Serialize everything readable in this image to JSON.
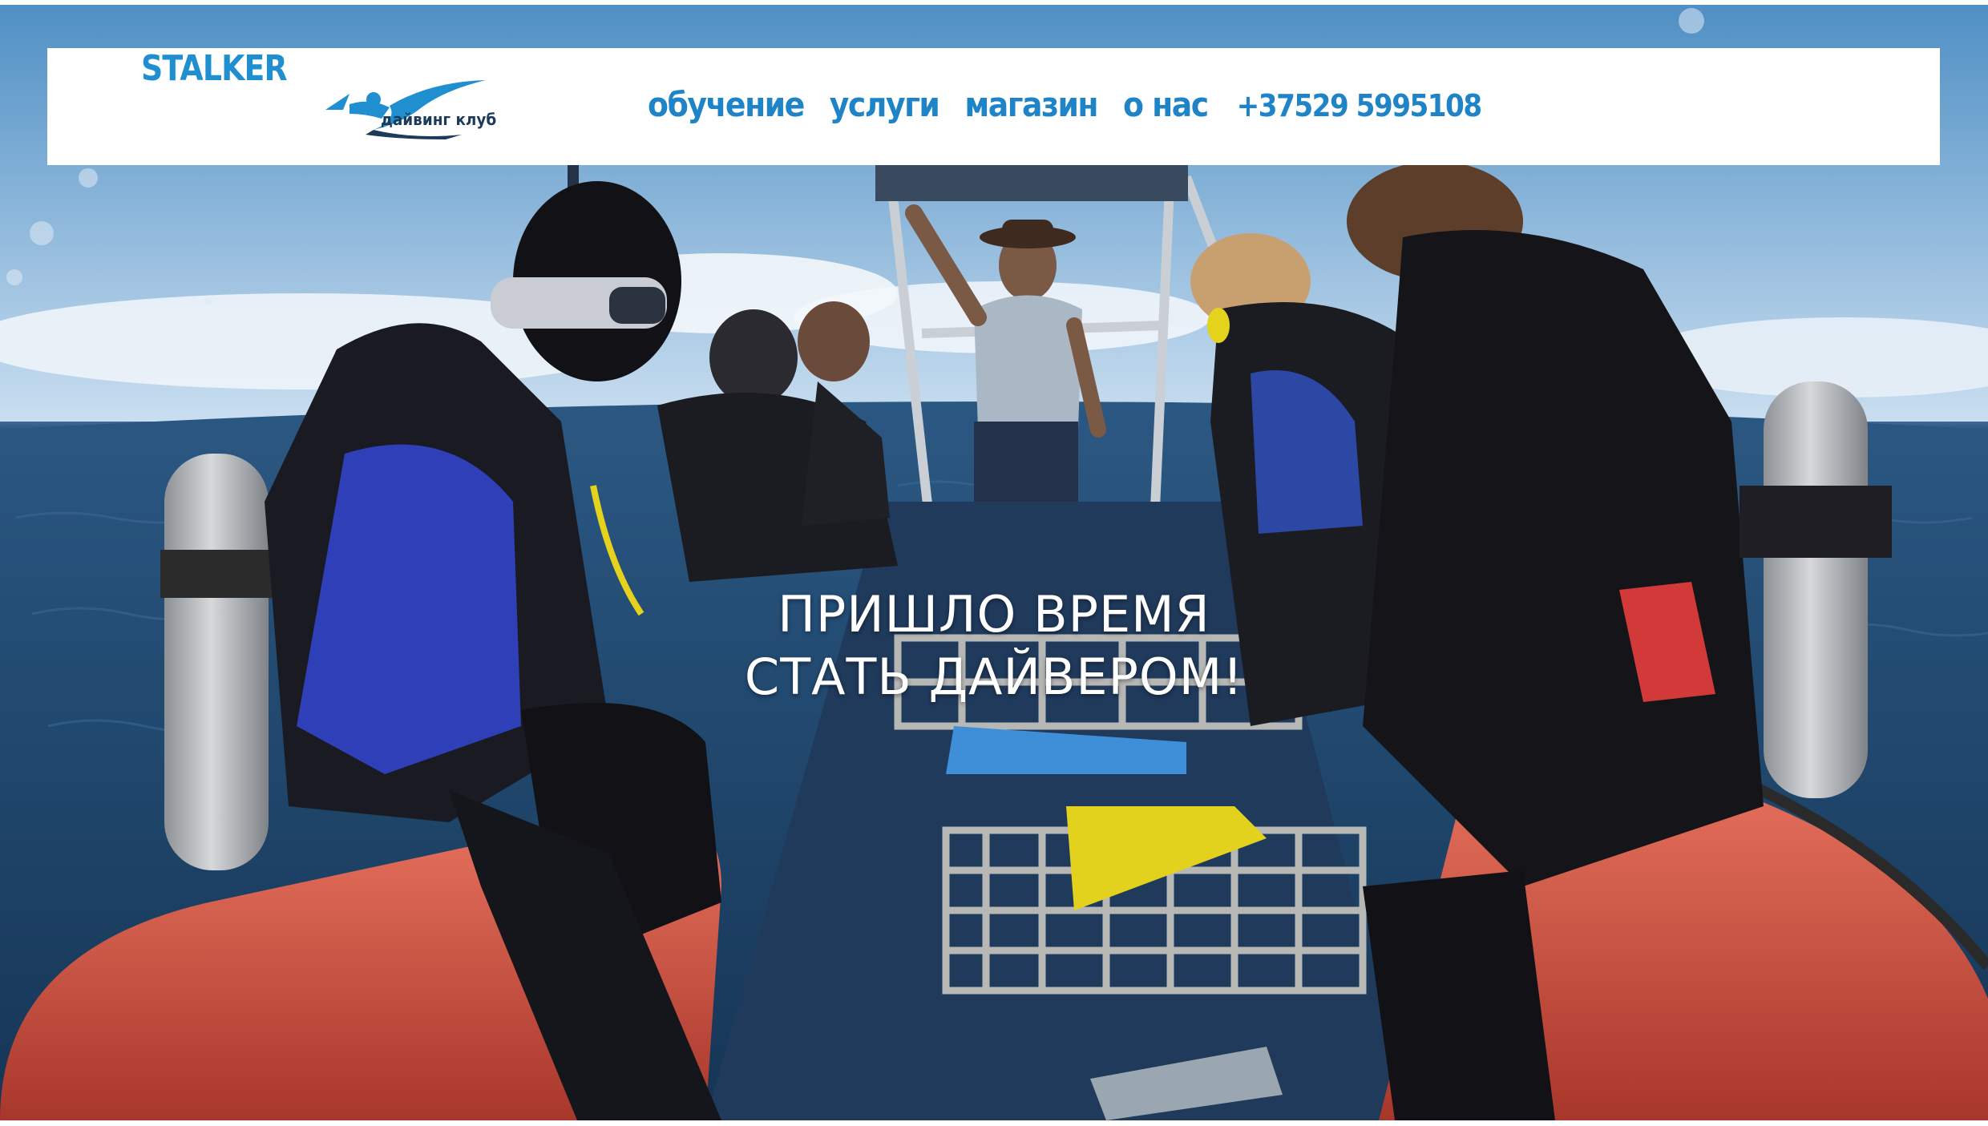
{
  "logo": {
    "name": "STALKER",
    "tagline": "дайвинг клуб",
    "color": "#1f8fd0",
    "icon": "diver-icon"
  },
  "nav": {
    "items": [
      {
        "label": "обучение"
      },
      {
        "label": "услуги"
      },
      {
        "label": "магазин"
      },
      {
        "label": "о нас"
      }
    ],
    "phone": "+37529 5995108",
    "color": "#1e84c7"
  },
  "hero": {
    "headline_line1": "ПРИШЛО ВРЕМЯ",
    "headline_line2": "СТАТЬ ДАЙВЕРОМ!"
  }
}
